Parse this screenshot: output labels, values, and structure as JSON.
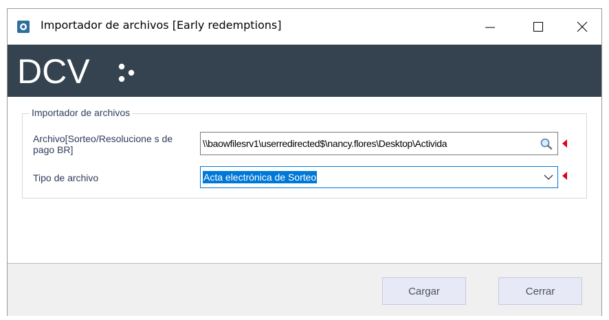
{
  "window": {
    "title": "Importador de archivos [Early redemptions]",
    "minimize_symbol": "—",
    "close_symbol": "✕"
  },
  "banner": {
    "logo_text": "DCV",
    "background": "#34434f"
  },
  "form": {
    "group_label": "Importador de archivos",
    "file_label": "Archivo[Sorteo/Resolucione s de pago BR]",
    "file_value": "\\\\baowfilesrv1\\userredirected$\\nancy.flores\\Desktop\\Activida",
    "type_label": "Tipo de archivo",
    "type_value": "Acta electrónica de Sorteo"
  },
  "buttons": {
    "load": "Cargar",
    "close": "Cerrar"
  },
  "colors": {
    "required_marker": "#e0001a",
    "accent": "#0078d7",
    "label": "#2f3b5c"
  },
  "icons": [
    "app-icon",
    "search-icon",
    "chevron-down-icon",
    "minimize-icon",
    "maximize-icon",
    "close-icon"
  ]
}
